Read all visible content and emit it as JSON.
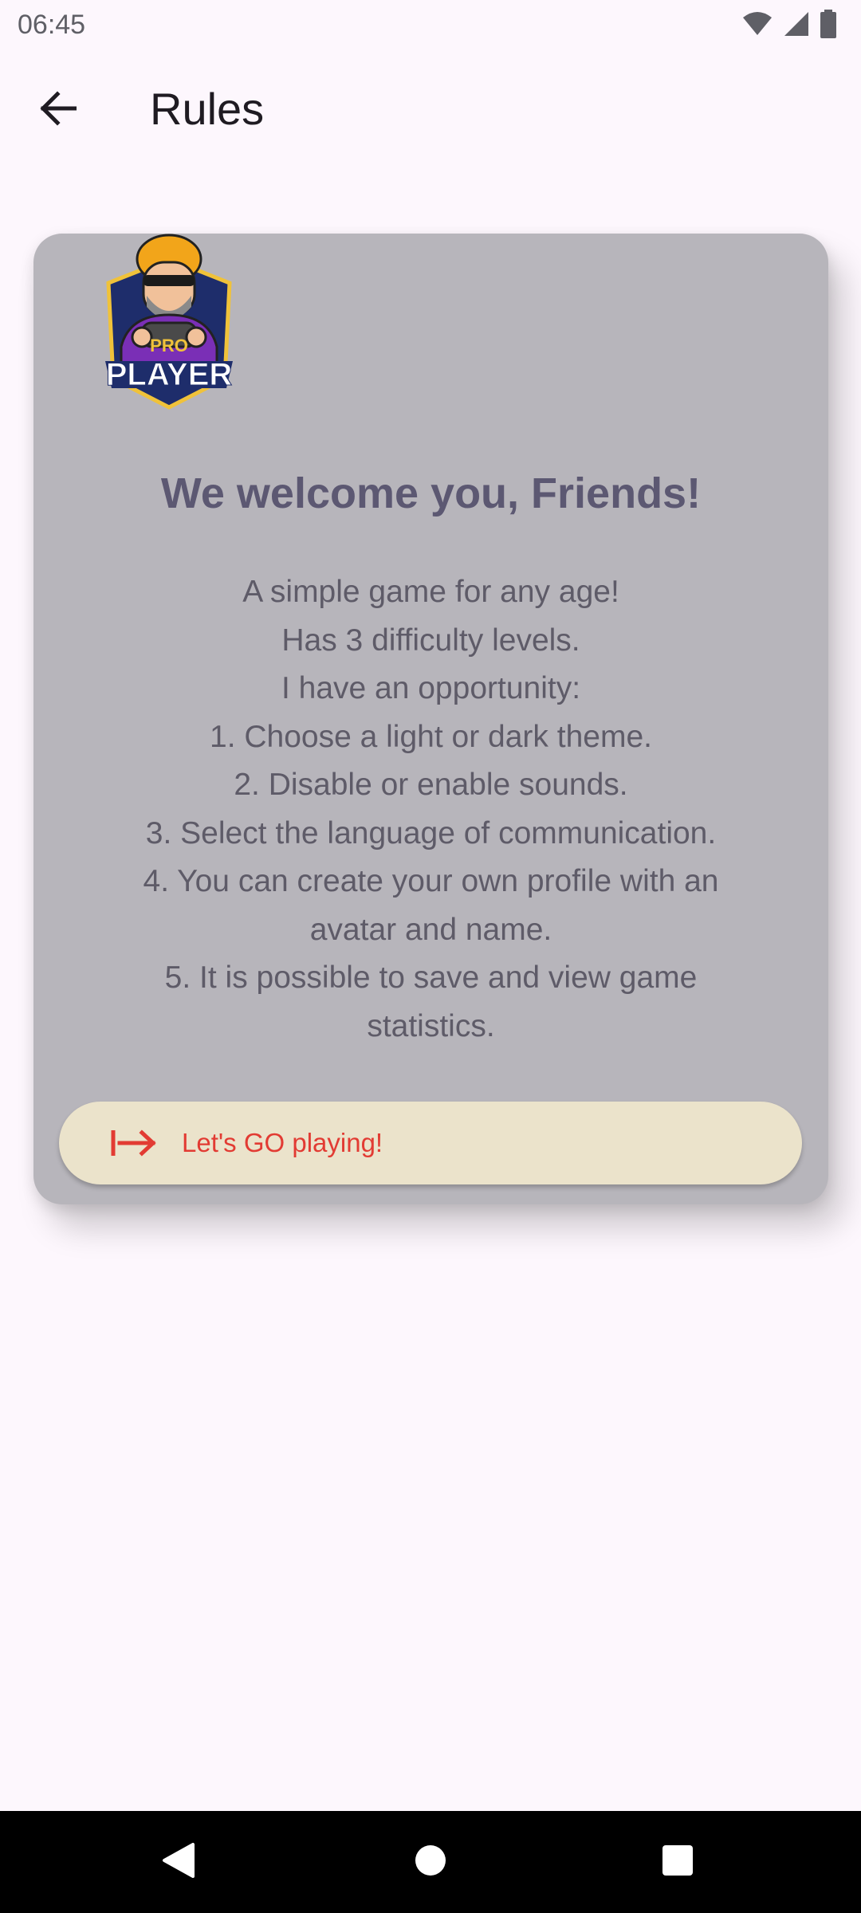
{
  "status_bar": {
    "time": "06:45",
    "icons": [
      "wifi-icon",
      "signal-icon",
      "battery-icon"
    ]
  },
  "app_bar": {
    "back_icon": "arrow-back-icon",
    "title": "Rules"
  },
  "card": {
    "logo": {
      "icon": "pro-player-logo",
      "text_top": "PRO",
      "text_bottom": "PLAYER"
    },
    "welcome_title": "We welcome you, Friends!",
    "rules_lines": [
      "A simple game for any age!",
      "Has 3 difficulty levels.",
      "I have an opportunity:",
      "1. Choose a light or dark theme.",
      "2. Disable or enable sounds.",
      "3. Select the language of communication.",
      "4. You can create your own profile with an",
      "avatar and name.",
      "5. It is possible to save and view game",
      "statistics."
    ],
    "go_button": {
      "icon": "login-arrow-icon",
      "label": "Let's GO playing!"
    }
  },
  "nav_bar": {
    "back": "nav-back-icon",
    "home": "nav-home-icon",
    "recents": "nav-recents-icon"
  },
  "colors": {
    "background": "#fdf7fd",
    "card": "#b7b5bb",
    "title": "#5c5872",
    "body_text": "#5e5b68",
    "button_bg": "#ebe3cb",
    "button_text": "#e23b33"
  }
}
